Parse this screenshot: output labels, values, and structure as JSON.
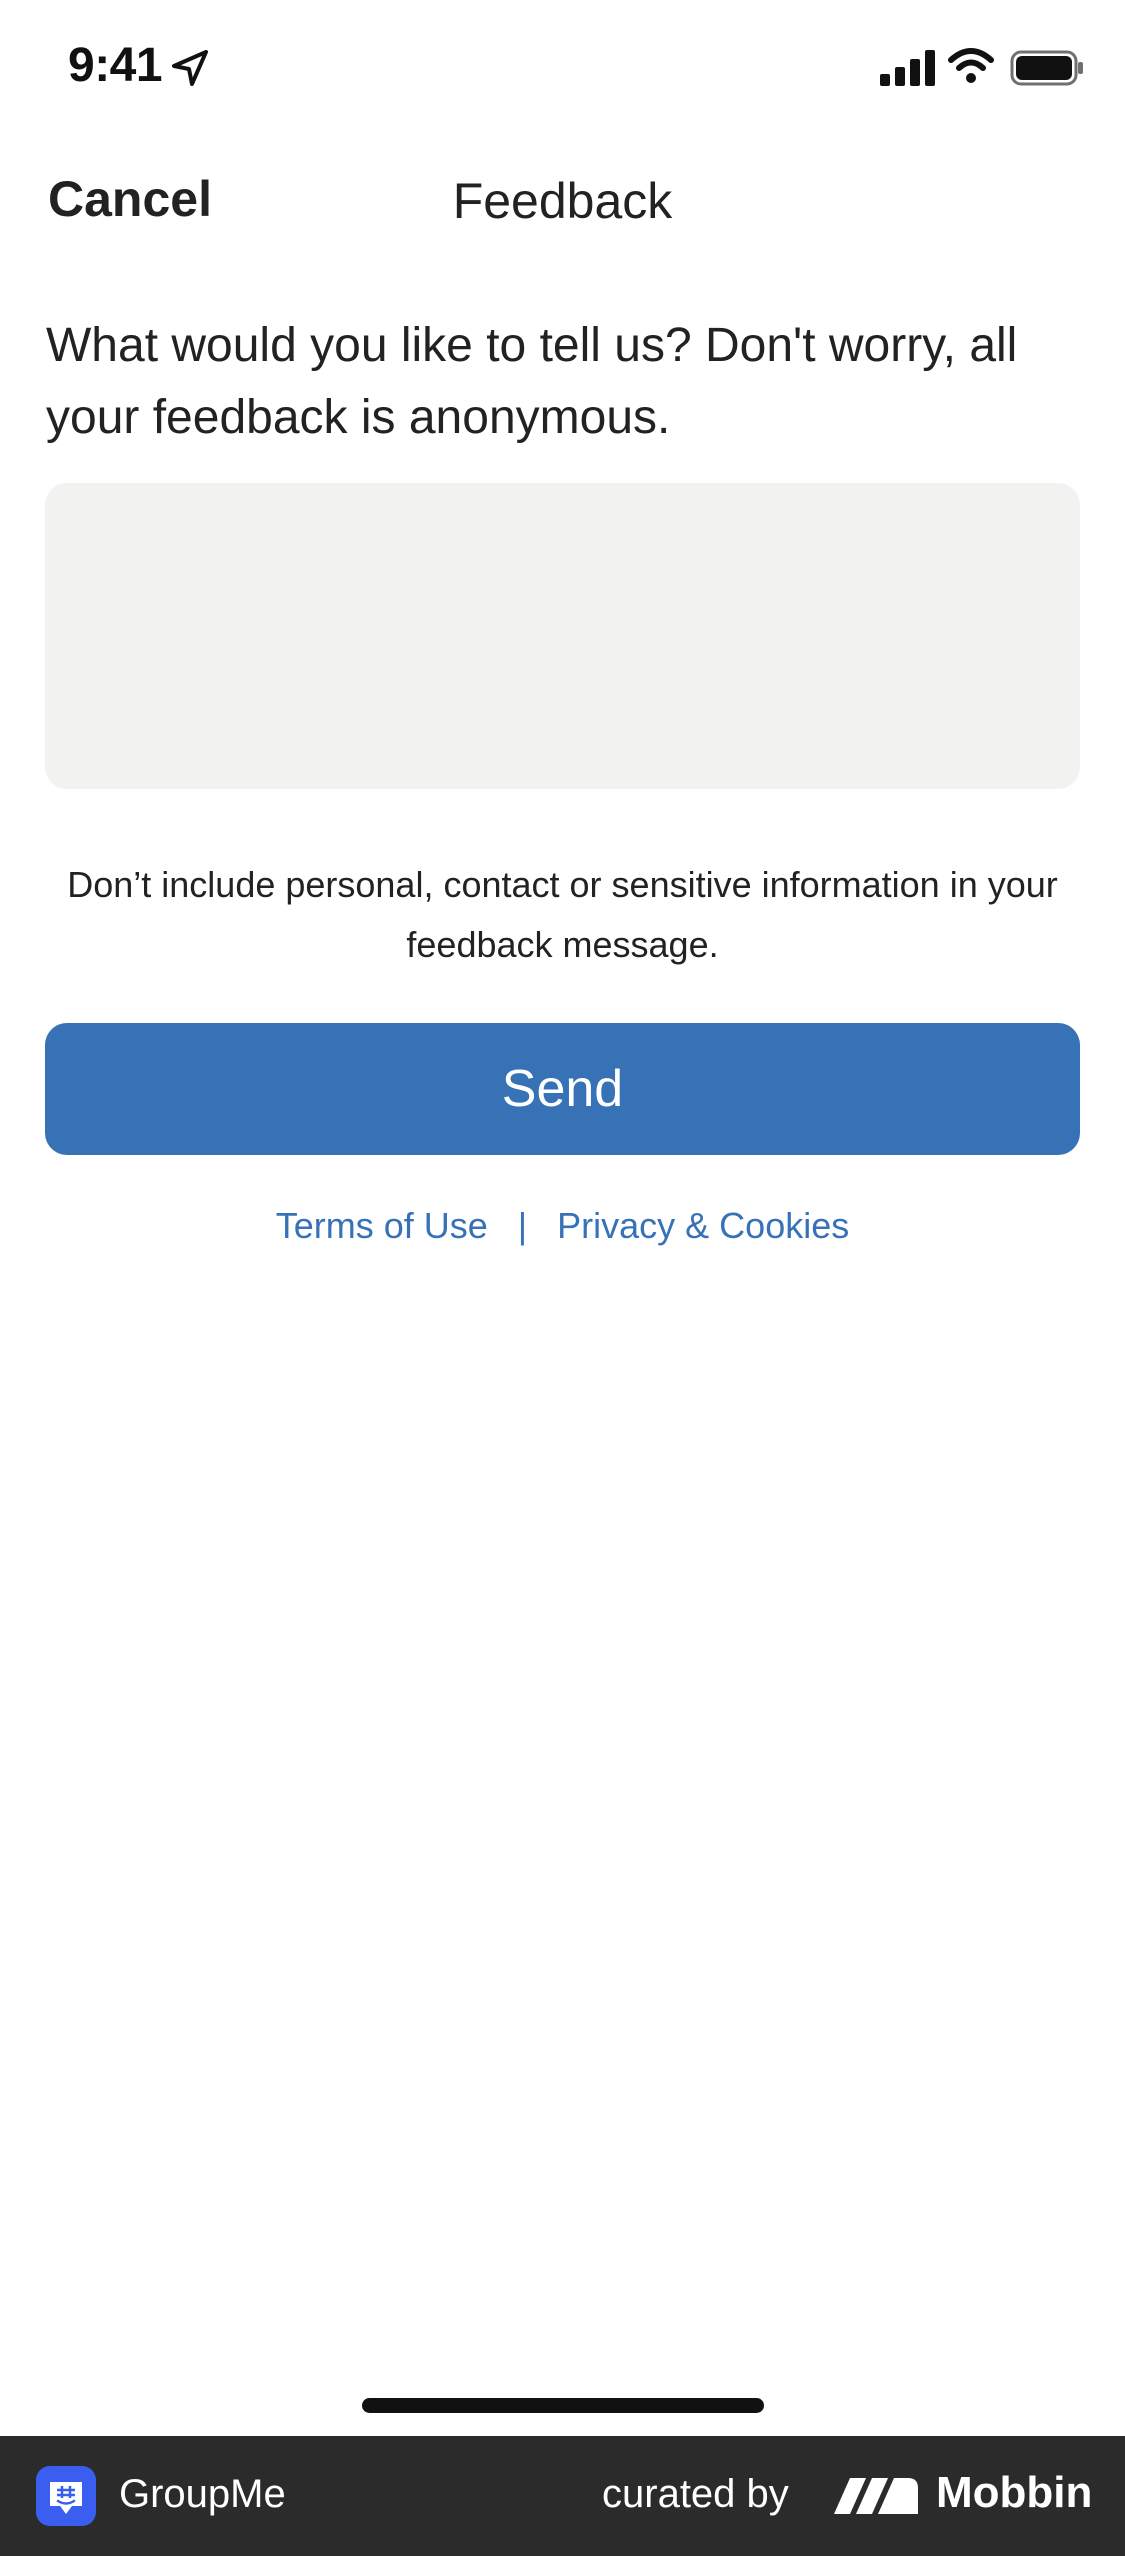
{
  "status_bar": {
    "time": "9:41",
    "icons": [
      "location-arrow-icon",
      "cellular-signal-icon",
      "wifi-icon",
      "battery-icon"
    ]
  },
  "nav": {
    "cancel_label": "Cancel",
    "title": "Feedback"
  },
  "form": {
    "prompt": "What would you like to tell us? Don't worry, all your feedback is anonymous.",
    "input_value": "",
    "input_placeholder": "",
    "disclaimer": "Don’t include personal, contact or sensitive information in your feedback message.",
    "send_label": "Send"
  },
  "links": {
    "terms": "Terms of Use",
    "separator": "|",
    "privacy": "Privacy & Cookies"
  },
  "brand_bar": {
    "app_name": "GroupMe",
    "curated_label": "curated by",
    "mobbin_name": "Mobbin"
  },
  "colors": {
    "accent": "#3872b6",
    "input_bg": "#f2f2f1",
    "brand_bar_bg": "#2b2b2b",
    "text": "#222222"
  }
}
